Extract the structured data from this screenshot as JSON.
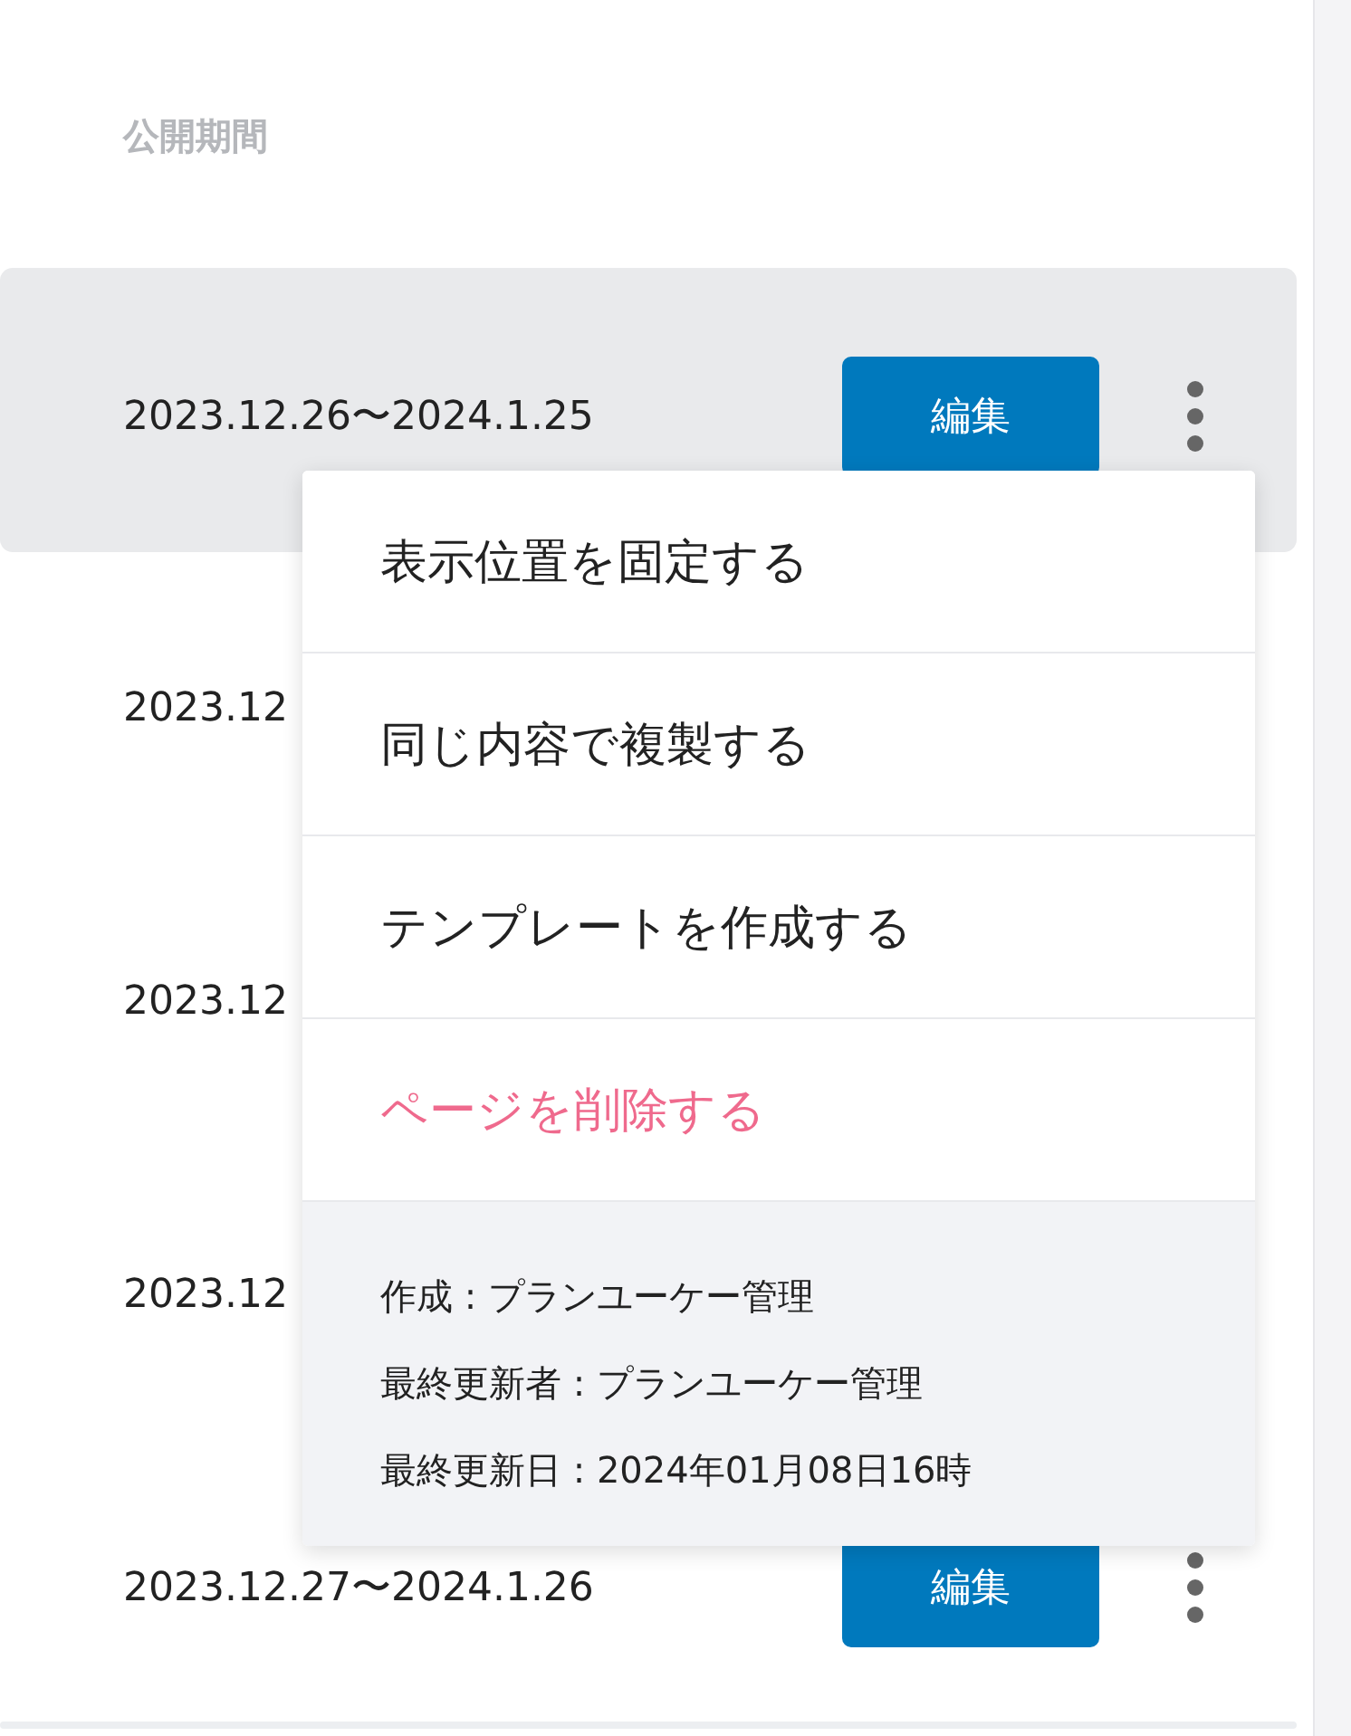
{
  "column_header": "公開期間",
  "rows": [
    {
      "date": "2023.12.26〜2024.1.25",
      "selected": true,
      "edit_label": "編集"
    },
    {
      "date": "2023.12",
      "selected": false
    },
    {
      "date": "2023.12",
      "selected": false
    },
    {
      "date": "2023.12",
      "selected": false
    },
    {
      "date": "2023.12.27〜2024.1.26",
      "selected": false,
      "edit_label": "編集"
    }
  ],
  "context_menu": {
    "items": [
      {
        "label": "表示位置を固定する",
        "kind": "normal"
      },
      {
        "label": "同じ内容で複製する",
        "kind": "normal"
      },
      {
        "label": "テンプレートを作成する",
        "kind": "normal"
      },
      {
        "label": "ページを削除する",
        "kind": "danger"
      }
    ],
    "info": [
      "作成 : プランユーケー管理",
      "最終更新者 : プランユーケー管理",
      "最終更新日 : 2024年01月08日16時"
    ]
  }
}
